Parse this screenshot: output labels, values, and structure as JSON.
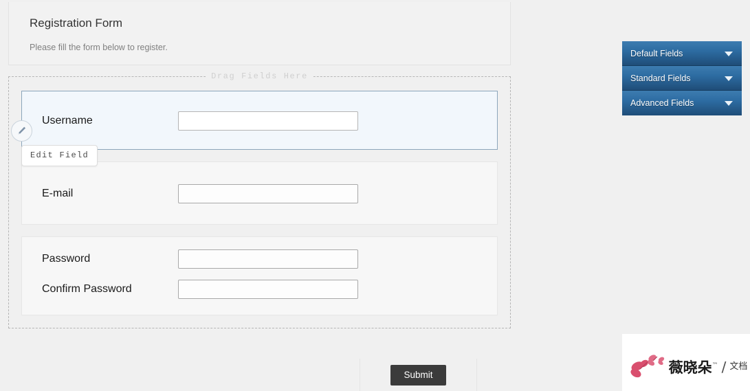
{
  "form": {
    "title": "Registration Form",
    "subtitle": "Please fill the form below to register.",
    "drop_zone_legend": "Drag Fields Here",
    "fields": [
      {
        "id": "username",
        "label": "Username",
        "value": "",
        "placeholder": "",
        "selected": true
      },
      {
        "id": "email",
        "label": "E-mail",
        "value": "",
        "placeholder": "",
        "selected": false
      },
      {
        "id": "password",
        "label": "Password",
        "value": "",
        "placeholder": "",
        "selected": false
      },
      {
        "id": "confirm-password",
        "label": "Confirm Password",
        "value": "",
        "placeholder": "",
        "selected": false
      }
    ],
    "submit_label": "Submit"
  },
  "edit_handle": {
    "icon": "pencil-icon",
    "tooltip": "Edit Field"
  },
  "fields_panel": {
    "sections": [
      {
        "label": "Default Fields",
        "icon": "chevron-down-icon"
      },
      {
        "label": "Standard Fields",
        "icon": "chevron-down-icon"
      },
      {
        "label": "Advanced Fields",
        "icon": "chevron-down-icon"
      }
    ]
  },
  "watermark": {
    "brand": "薇晓朵",
    "tm": "™",
    "separator": "/",
    "sub": "文档"
  },
  "colors": {
    "page_background": "#f0f0f0",
    "panel_blue_top": "#3d7cb0",
    "panel_blue_bottom": "#1f4d78",
    "selected_field_background": "#f2f7fc",
    "selected_field_border": "#8ba5bb",
    "submit_button": "#3b3b3b",
    "title_text": "#333333",
    "subtitle_text": "#808080",
    "legend_text": "#cfcfcf"
  }
}
